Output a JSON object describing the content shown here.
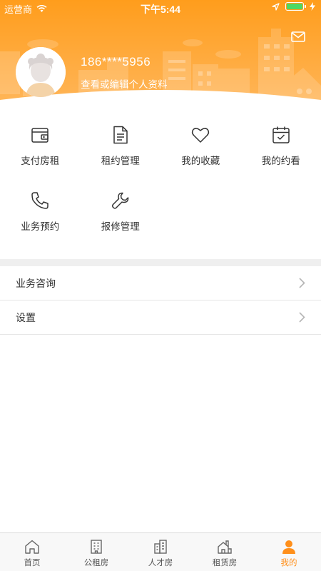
{
  "status_bar": {
    "carrier": "运营商",
    "time": "下午5:44"
  },
  "profile": {
    "phone": "186****5956",
    "edit_link": "查看或编辑个人资料"
  },
  "colors": {
    "accent": "#ff8f1a",
    "header_top": "#ffa423",
    "header_bottom": "#ffb85a"
  },
  "shortcuts": [
    {
      "label": "支付房租",
      "icon": "wallet-icon"
    },
    {
      "label": "租约管理",
      "icon": "document-icon"
    },
    {
      "label": "我的收藏",
      "icon": "heart-icon"
    },
    {
      "label": "我的约看",
      "icon": "calendar-check-icon"
    },
    {
      "label": "业务预约",
      "icon": "phone-icon"
    },
    {
      "label": "报修管理",
      "icon": "wrench-icon"
    }
  ],
  "menu": [
    {
      "label": "业务咨询"
    },
    {
      "label": "设置"
    }
  ],
  "tabs": [
    {
      "label": "首页",
      "icon": "home-icon",
      "active": false
    },
    {
      "label": "公租房",
      "icon": "building-icon",
      "active": false
    },
    {
      "label": "人才房",
      "icon": "apartment-icon",
      "active": false
    },
    {
      "label": "租赁房",
      "icon": "house-icon",
      "active": false
    },
    {
      "label": "我的",
      "icon": "user-icon",
      "active": true
    }
  ]
}
